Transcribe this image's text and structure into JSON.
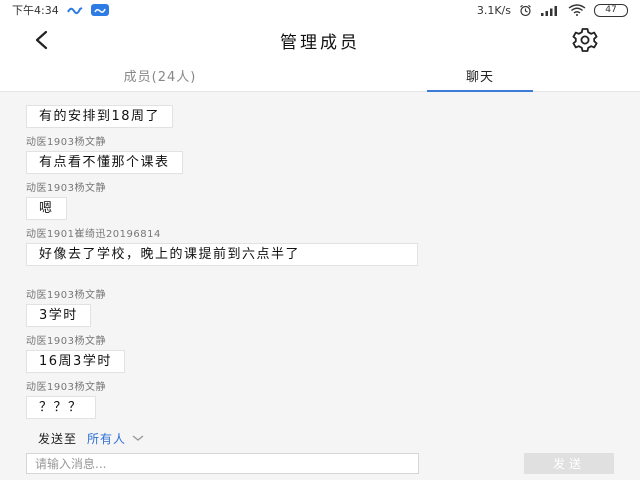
{
  "status_bar": {
    "time": "下午4:34",
    "speed": "3.1K/s",
    "battery": "47"
  },
  "header": {
    "title": "管理成员"
  },
  "tabs": [
    {
      "label": "成员(24人)",
      "active": false
    },
    {
      "label": "聊天",
      "active": true
    }
  ],
  "messages": [
    {
      "sender": "",
      "text": "有的安排到18周了"
    },
    {
      "sender": "动医1903杨文静",
      "text": "有点看不懂那个课表"
    },
    {
      "sender": "动医1903杨文静",
      "text": "嗯"
    },
    {
      "sender": "动医1901崔绮迅20196814",
      "text": "好像去了学校，晚上的课提前到六点半了"
    },
    {
      "sender": "动医1903杨文静",
      "text": "3学时"
    },
    {
      "sender": "动医1903杨文静",
      "text": "16周3学时"
    },
    {
      "sender": "动医1903杨文静",
      "text": "？？？"
    }
  ],
  "composer": {
    "send_to_label": "发送至",
    "recipient": "所有人",
    "placeholder": "请输入消息...",
    "send_label": "发送"
  },
  "colors": {
    "accent": "#3d7bd8",
    "chat_background": "#f5f5f5",
    "send_button_disabled": "#e0e0e0"
  }
}
